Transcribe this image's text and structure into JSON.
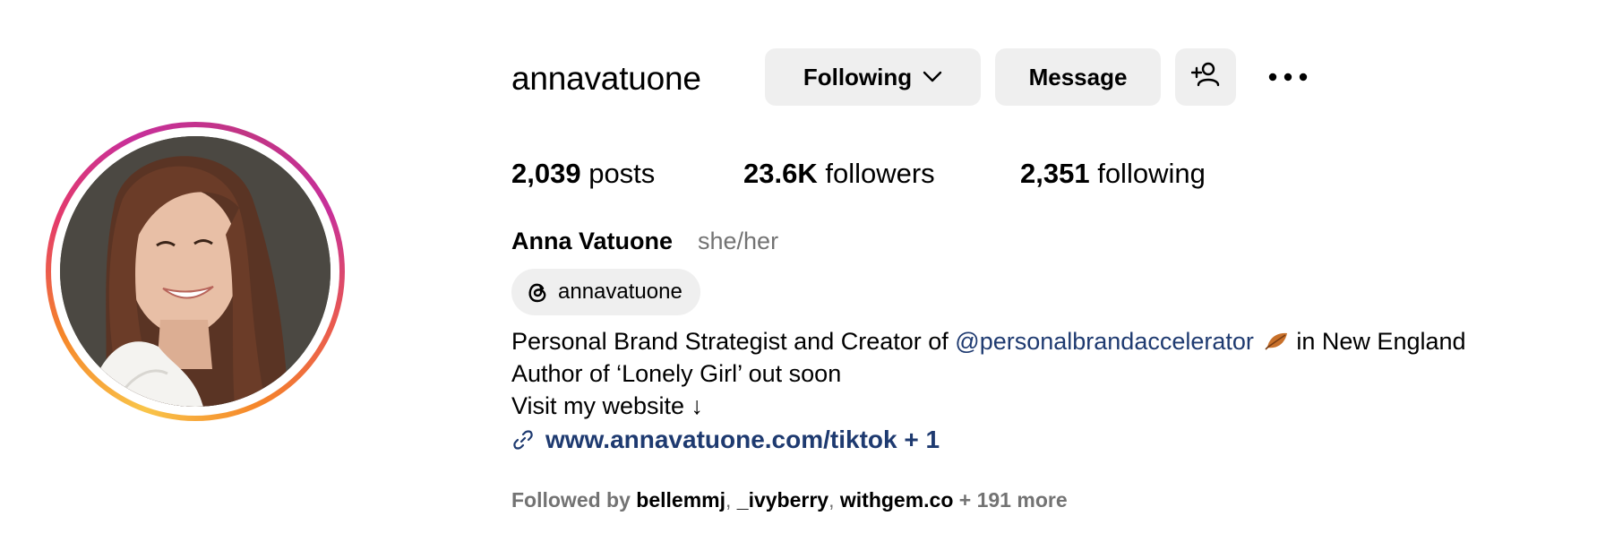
{
  "profile": {
    "username": "annavatuone",
    "full_name": "Anna Vatuone",
    "pronouns": "she/her"
  },
  "actions": {
    "following_label": "Following",
    "message_label": "Message",
    "add_user_icon": "person-add-icon",
    "more_icon": "more-options-icon"
  },
  "stats": {
    "posts_count": "2,039",
    "posts_label": "posts",
    "followers_count": "23.6K",
    "followers_label": "followers",
    "following_count": "2,351",
    "following_label": "following"
  },
  "threads": {
    "handle": "annavatuone",
    "icon": "threads-icon"
  },
  "bio": {
    "line1_prefix": "Personal Brand Strategist and Creator of ",
    "line1_mention": "@personalbrandaccelerator",
    "line1_emoji": "fallen-leaf-emoji",
    "line1_suffix": "in New England",
    "line2": "Author of ‘Lonely Girl’ out soon",
    "line3": "Visit my website ↓"
  },
  "link": {
    "icon": "link-icon",
    "text": "www.annavatuone.com/tiktok + 1"
  },
  "followed_by": {
    "label": "Followed by",
    "users": [
      "bellemmj",
      "_ivyberry",
      "withgem.co"
    ],
    "more": "+ 191 more"
  },
  "colors": {
    "link_blue": "#1e3a70",
    "secondary_text": "#737373",
    "button_bg": "#efefef",
    "ring_start": "#f9c54a",
    "ring_end": "#c13584"
  }
}
